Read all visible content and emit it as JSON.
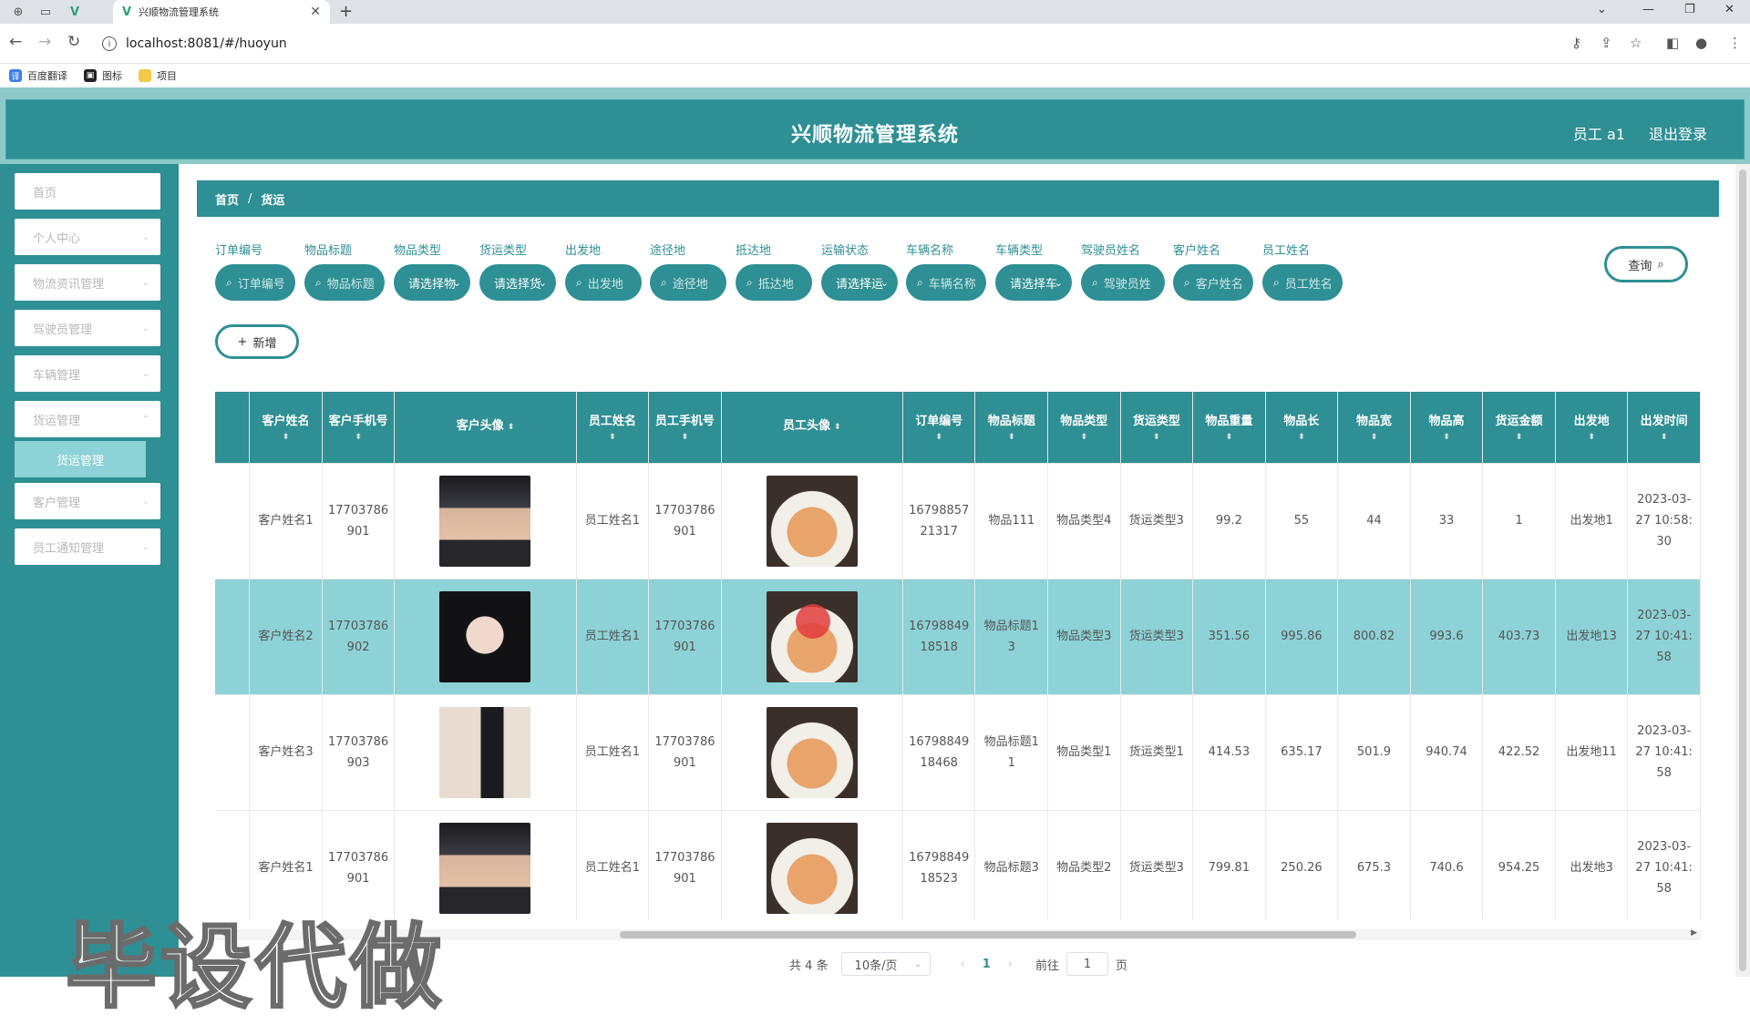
{
  "browser": {
    "tab_title": "兴顺物流管理系统",
    "url": "localhost:8081/#/huoyun",
    "bookmarks": [
      "百度翻译",
      "图标",
      "项目"
    ]
  },
  "header": {
    "title": "兴顺物流管理系统",
    "user": "员工 a1",
    "logout": "退出登录"
  },
  "sidebar": {
    "items": [
      "首页",
      "个人中心",
      "物流资讯管理",
      "驾驶员管理",
      "车辆管理",
      "货运管理",
      "客户管理",
      "员工通知管理"
    ],
    "active_sub": "货运管理"
  },
  "breadcrumb": {
    "home": "首页",
    "current": "货运"
  },
  "filters": [
    {
      "label": "订单编号",
      "placeholder": "订单编号",
      "type": "input"
    },
    {
      "label": "物品标题",
      "placeholder": "物品标题",
      "type": "input"
    },
    {
      "label": "物品类型",
      "placeholder": "请选择物",
      "type": "select"
    },
    {
      "label": "货运类型",
      "placeholder": "请选择货",
      "type": "select"
    },
    {
      "label": "出发地",
      "placeholder": "出发地",
      "type": "input"
    },
    {
      "label": "途径地",
      "placeholder": "途径地",
      "type": "input"
    },
    {
      "label": "抵达地",
      "placeholder": "抵达地",
      "type": "input"
    },
    {
      "label": "运输状态",
      "placeholder": "请选择运",
      "type": "select"
    },
    {
      "label": "车辆名称",
      "placeholder": "车辆名称",
      "type": "input"
    },
    {
      "label": "车辆类型",
      "placeholder": "请选择车",
      "type": "select"
    },
    {
      "label": "驾驶员姓名",
      "placeholder": "驾驶员姓",
      "type": "input"
    },
    {
      "label": "客户姓名",
      "placeholder": "客户姓名",
      "type": "input"
    },
    {
      "label": "员工姓名",
      "placeholder": "员工姓名",
      "type": "input"
    }
  ],
  "buttons": {
    "query": "查询",
    "add": "新增"
  },
  "table": {
    "columns": [
      "客户姓名",
      "客户手机号",
      "客户头像",
      "员工姓名",
      "员工手机号",
      "员工头像",
      "订单编号",
      "物品标题",
      "物品类型",
      "货运类型",
      "物品重量",
      "物品长",
      "物品宽",
      "物品高",
      "货运金额",
      "出发地",
      "出发时间"
    ],
    "rows": [
      {
        "customer": "客户姓名1",
        "customer_phone": "17703786901",
        "customer_avatar": "man",
        "staff": "员工姓名1",
        "staff_phone": "17703786901",
        "staff_avatar": "cat",
        "order_no": "1679885721317",
        "title": "物品111",
        "item_type": "物品类型4",
        "freight_type": "货运类型3",
        "weight": "99.2",
        "length": "55",
        "width": "44",
        "height": "33",
        "amount": "1",
        "origin": "出发地1",
        "depart": "2023-03-27 10:58:30"
      },
      {
        "customer": "客户姓名2",
        "customer_phone": "17703786902",
        "customer_avatar": "girl",
        "staff": "员工姓名1",
        "staff_phone": "17703786901",
        "staff_avatar": "cat",
        "order_no": "1679884918518",
        "title": "物品标题13",
        "item_type": "物品类型3",
        "freight_type": "货运类型3",
        "weight": "351.56",
        "length": "995.86",
        "width": "800.82",
        "height": "993.6",
        "amount": "403.73",
        "origin": "出发地13",
        "depart": "2023-03-27 10:41:58"
      },
      {
        "customer": "客户姓名3",
        "customer_phone": "17703786903",
        "customer_avatar": "back",
        "staff": "员工姓名1",
        "staff_phone": "17703786901",
        "staff_avatar": "cat",
        "order_no": "1679884918468",
        "title": "物品标题11",
        "item_type": "物品类型1",
        "freight_type": "货运类型1",
        "weight": "414.53",
        "length": "635.17",
        "width": "501.9",
        "height": "940.74",
        "amount": "422.52",
        "origin": "出发地11",
        "depart": "2023-03-27 10:41:58"
      },
      {
        "customer": "客户姓名1",
        "customer_phone": "17703786901",
        "customer_avatar": "man",
        "staff": "员工姓名1",
        "staff_phone": "17703786901",
        "staff_avatar": "cat",
        "order_no": "1679884918523",
        "title": "物品标题3",
        "item_type": "物品类型2",
        "freight_type": "货运类型3",
        "weight": "799.81",
        "length": "250.26",
        "width": "675.3",
        "height": "740.6",
        "amount": "954.25",
        "origin": "出发地3",
        "depart": "2023-03-27 10:41:58"
      }
    ],
    "highlighted_row": 1
  },
  "pagination": {
    "total": "共 4 条",
    "page_size": "10条/页",
    "current_page": "1",
    "goto_label": "前往",
    "goto_value": "1",
    "page_suffix": "页"
  },
  "watermark": "毕设代做"
}
